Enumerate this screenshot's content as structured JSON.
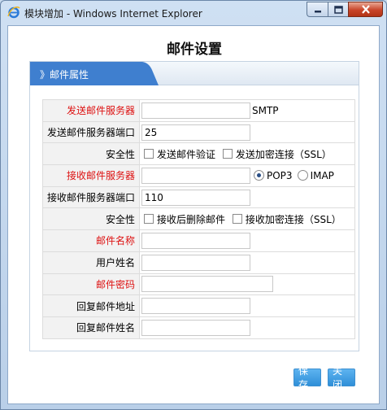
{
  "window": {
    "title": "模块增加 - Windows Internet Explorer"
  },
  "page": {
    "title": "邮件设置"
  },
  "panel": {
    "header": "》邮件属性"
  },
  "form": {
    "rows": [
      {
        "label": "发送邮件服务器",
        "required": true,
        "value": "",
        "suffix": "SMTP"
      },
      {
        "label": "发送邮件服务器端口",
        "required": false,
        "value": "25"
      },
      {
        "label": "安全性",
        "required": false,
        "options": [
          "发送邮件验证",
          "发送加密连接（SSL）"
        ]
      },
      {
        "label": "接收邮件服务器",
        "required": true,
        "value": "",
        "protocol_options": [
          "POP3",
          "IMAP"
        ],
        "protocol_selected": "POP3"
      },
      {
        "label": "接收邮件服务器端口",
        "required": false,
        "value": "110"
      },
      {
        "label": "安全性",
        "required": false,
        "options": [
          "接收后删除邮件",
          "接收加密连接（SSL）"
        ]
      },
      {
        "label": "邮件名称",
        "required": true,
        "value": ""
      },
      {
        "label": "用户姓名",
        "required": false,
        "value": ""
      },
      {
        "label": "邮件密码",
        "required": true,
        "value": ""
      },
      {
        "label": "回复邮件地址",
        "required": false,
        "value": ""
      },
      {
        "label": "回复邮件姓名",
        "required": false,
        "value": ""
      }
    ]
  },
  "buttons": {
    "save": "保存",
    "close": "关闭"
  },
  "colors": {
    "required_label": "#dd1111",
    "accent": "#3a97e0"
  }
}
